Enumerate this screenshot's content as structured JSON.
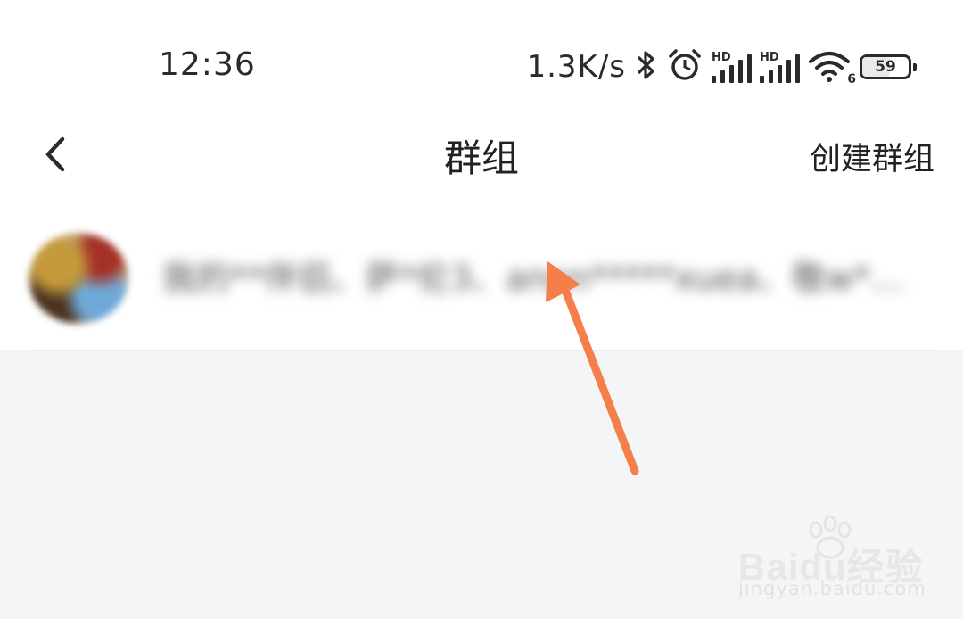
{
  "status_bar": {
    "time": "12:36",
    "net_speed": "1.3K/s",
    "icons": [
      "bluetooth-icon",
      "alarm-icon",
      "signal-hd-icon",
      "signal-hd-icon",
      "wifi-icon",
      "battery-icon"
    ],
    "signal_label": "HD",
    "wifi_label": "6",
    "battery_level": "59"
  },
  "nav": {
    "back_icon": "chevron-left-icon",
    "title": "群组",
    "action": "创建群组"
  },
  "groups": [
    {
      "avatar": "group-avatar",
      "name": "我的**伴侣、萨*伦3、anon*****xuea、敬w*…"
    }
  ],
  "colors": {
    "arrow": "#f47f4a",
    "page_background": "#f4f5f7",
    "header_background": "#ffffff"
  },
  "watermark": {
    "brand": "Baidu经验",
    "url": "jingyan.baidu.com"
  }
}
